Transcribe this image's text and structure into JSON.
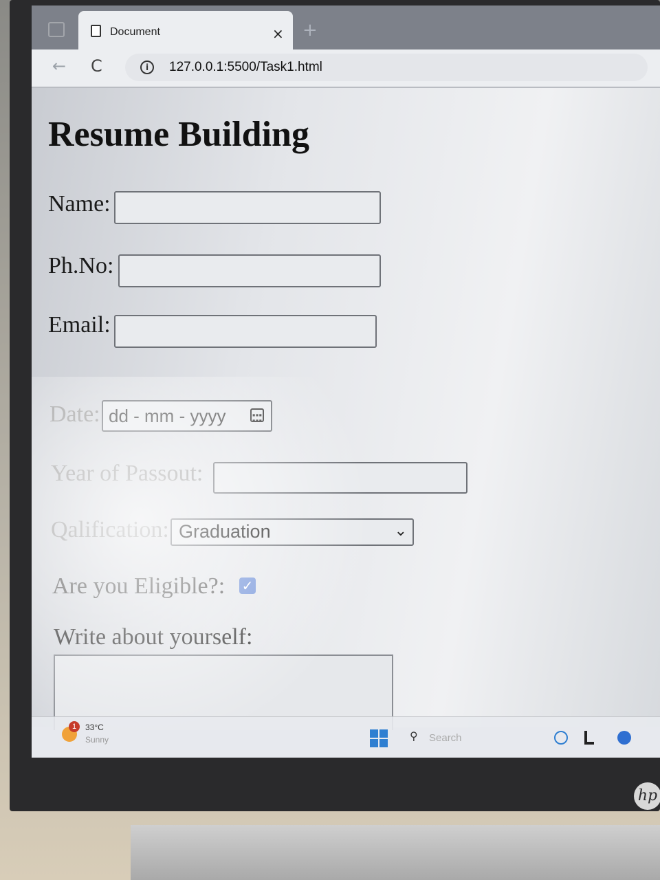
{
  "browser": {
    "tab_title": "Document",
    "tab_close": "×",
    "new_tab": "+",
    "back": "←",
    "reload": "C",
    "info": "i",
    "url": "127.0.0.1:5500/Task1.html"
  },
  "page": {
    "title": "Resume Building",
    "fields": {
      "name_label": "Name:",
      "phone_label": "Ph.No:",
      "email_label": "Email:",
      "date_label": "Date:",
      "date_placeholder": "dd - mm - yyyy",
      "passout_label": "Year of Passout:",
      "qualification_label": "Qalification:",
      "qualification_value": "Graduation",
      "eligible_label": "Are you Eligible?:",
      "eligible_checked": true,
      "about_label": "Write about yourself:"
    }
  },
  "taskbar": {
    "weather_badge": "1",
    "weather_temp": "33°C",
    "weather_desc": "Sunny",
    "search_label": "Search"
  }
}
